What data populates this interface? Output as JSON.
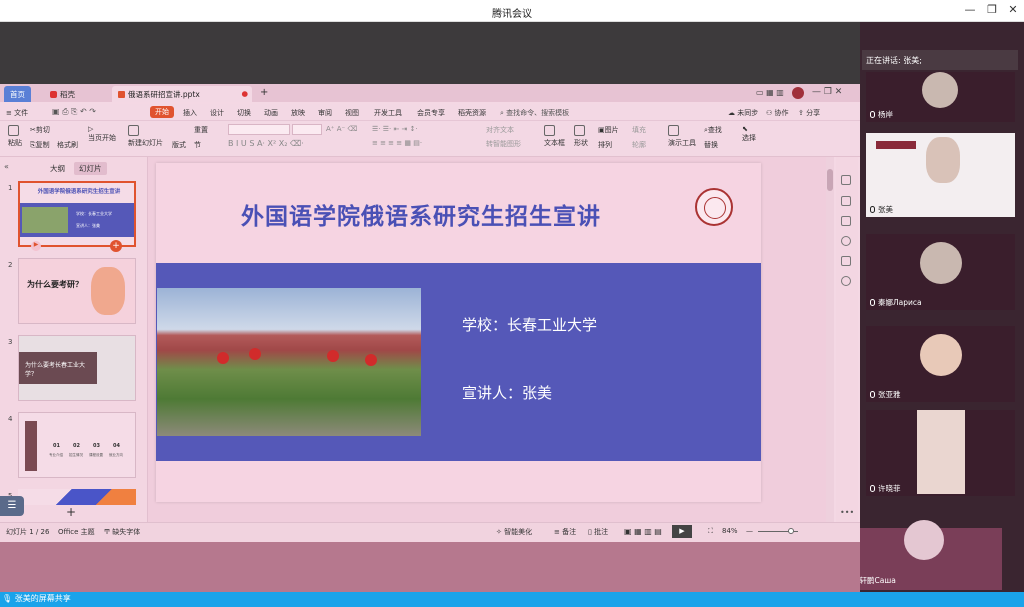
{
  "window": {
    "title": "腾讯会议",
    "controls": [
      "—",
      "❐",
      "✕"
    ]
  },
  "tabs": [
    {
      "label": "首页"
    },
    {
      "label": "稻壳"
    },
    {
      "label": "俄语系研招宣讲.pptx"
    },
    {
      "label": "+"
    }
  ],
  "menu": [
    "≡ 文件",
    "开始",
    "插入",
    "设计",
    "切换",
    "动画",
    "放映",
    "审阅",
    "视图",
    "开发工具",
    "会员专享",
    "稻壳资源"
  ],
  "search_placeholder": "查找命令、搜索模板",
  "menu_right": {
    "unsynced": "未同步",
    "collab": "协作",
    "share": "分享"
  },
  "ribbon": {
    "paste": "粘贴",
    "cut": "剪切",
    "copy": "复制",
    "format_painter": "格式刷",
    "from_current": "当页开始",
    "new_slide": "新建幻灯片",
    "layout": "版式",
    "section": "节",
    "reset": "重置",
    "textbox": "文本框",
    "shape": "形状",
    "arrange": "排列",
    "image": "图片",
    "fill": "填充",
    "outline": "轮廓",
    "presenter_tools": "演示工具",
    "find": "查找",
    "replace": "替换",
    "select": "选择",
    "align_text": "对齐文本",
    "smartart": "转智能图形"
  },
  "panel_tabs": {
    "outline": "大纲",
    "slides": "幻灯片"
  },
  "thumbs": [
    {
      "num": "1",
      "title": "外国语学院俄语系研究生招生宣讲",
      "line1": "学校：长春工业大学",
      "line2": "宣讲人：张美"
    },
    {
      "num": "2",
      "title": "为什么要考研？"
    },
    {
      "num": "3",
      "title": "为什么要考长春工业大学？"
    },
    {
      "num": "4",
      "steps": [
        "01",
        "02",
        "03",
        "04"
      ],
      "labels": [
        "专业介绍",
        "招生情况",
        "课程设置",
        "就业方向"
      ]
    },
    {
      "num": "5"
    }
  ],
  "slide": {
    "title": "外国语学院俄语系研究生招生宣讲",
    "school": "学校：长春工业大学",
    "speaker": "宣讲人：张美"
  },
  "status": {
    "slide_count": "幻灯片 1 / 26",
    "theme": "Office 主题",
    "missing_fonts": "缺失字体",
    "smart_beautify": "智能美化",
    "notes": "备注",
    "comments": "批注",
    "zoom": "84%"
  },
  "meeting": {
    "speaking": "正在讲话: 张美;",
    "participants": [
      "杨岸",
      "张美",
      "秦娜Лариса",
      "张亚雅",
      "许晓菲",
      "杜轩鹏Саша"
    ]
  },
  "share_label": "张美的屏幕共享",
  "colors": {
    "accent": "#4a50b5",
    "band": "#5558b8",
    "share_bar": "#1aa3ea"
  }
}
